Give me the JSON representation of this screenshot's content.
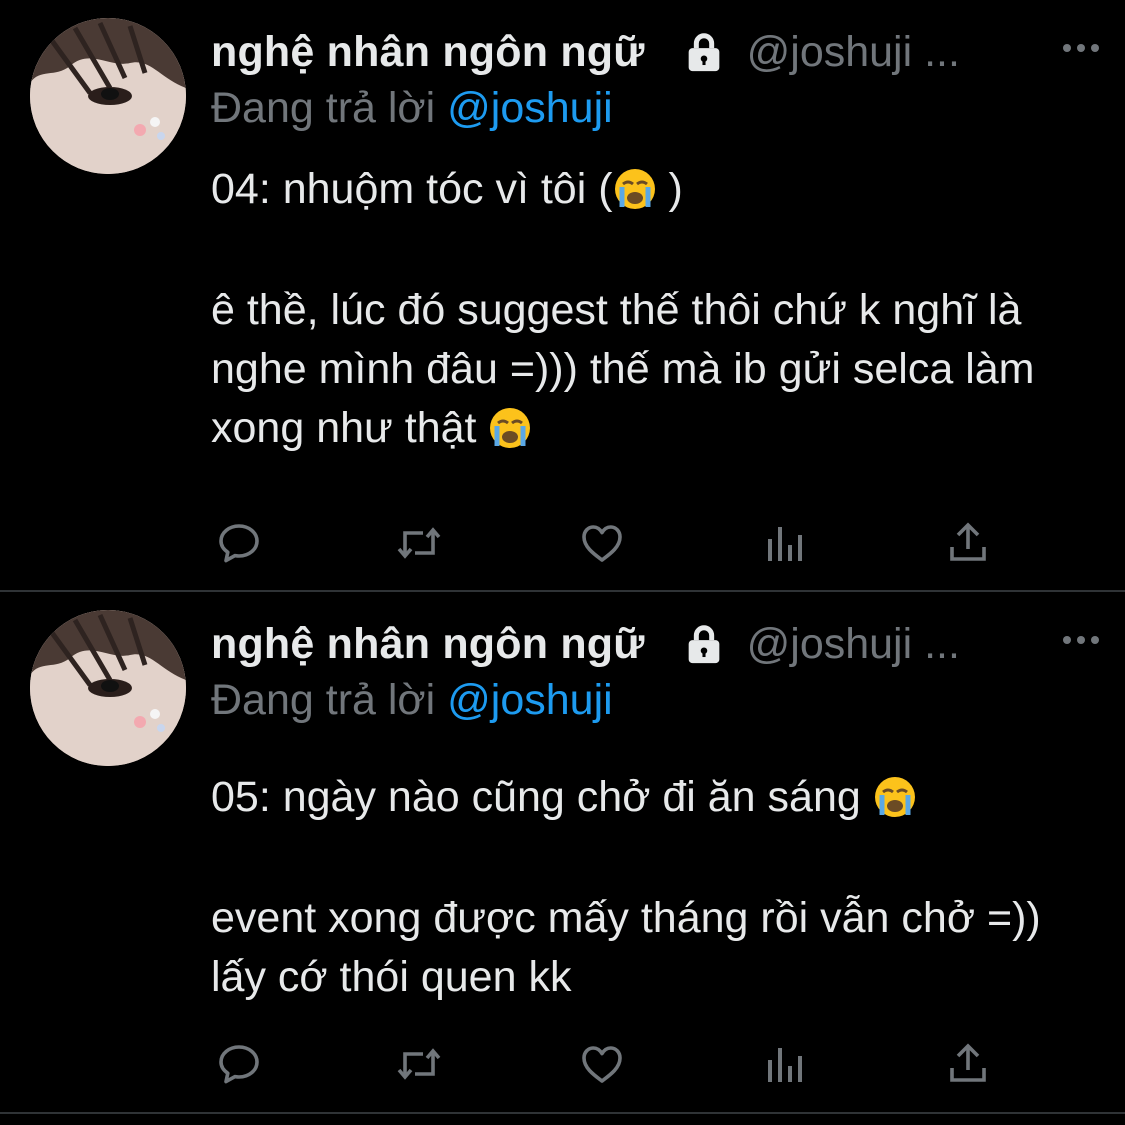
{
  "colors": {
    "background": "#000000",
    "text_primary": "#e7e9ea",
    "text_secondary": "#71767b",
    "link": "#1d9bf0",
    "divider": "#2f3336"
  },
  "tweets": [
    {
      "display_name": "nghệ nhân ngôn ngữ",
      "handle": "@joshuji ...",
      "replying_prefix": "Đang trả lời",
      "replying_to": "@joshuji",
      "text_line_1": "04: nhuộm tóc vì tôi (",
      "text_line_1_end": " )",
      "text_para_2": "ê thề, lúc đó suggest thế thôi chứ k nghĩ là nghe mình đâu =))) thế mà ib gửi selca làm xong như thật ",
      "icons": [
        "lock-icon",
        "more-icon",
        "reply-icon",
        "retweet-icon",
        "like-icon",
        "views-icon",
        "share-icon",
        "loudly-crying-face-emoji"
      ]
    },
    {
      "display_name": "nghệ nhân ngôn ngữ",
      "handle": "@joshuji ...",
      "replying_prefix": "Đang trả lời",
      "replying_to": "@joshuji",
      "text_line_1": "05: ngày nào cũng chở đi ăn sáng ",
      "text_para_2": "event xong được mấy tháng rồi vẫn chở =)) lấy cớ thói quen kk",
      "icons": [
        "lock-icon",
        "more-icon",
        "reply-icon",
        "retweet-icon",
        "like-icon",
        "views-icon",
        "share-icon",
        "loudly-crying-face-emoji"
      ]
    }
  ]
}
